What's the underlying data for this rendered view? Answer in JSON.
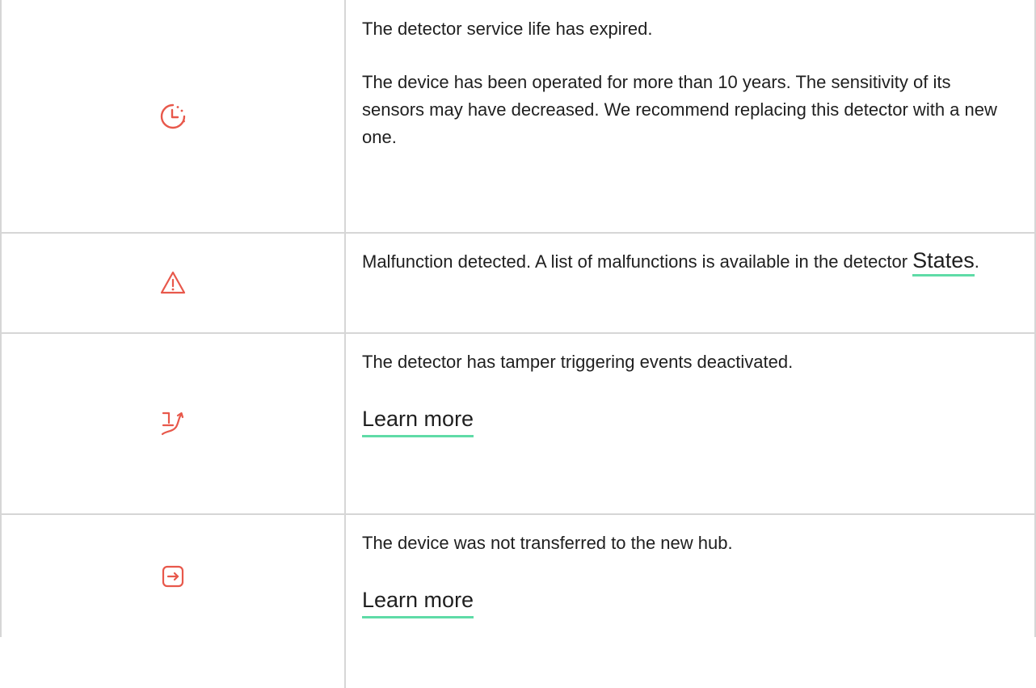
{
  "rows": [
    {
      "icon": "service-life-clock-icon",
      "lines": [
        "The detector service life has expired.",
        "The device has been operated for more than 10 years. The sensitivity of its sensors may have decreased. We recommend replacing this detector with a new one."
      ]
    },
    {
      "icon": "warning-triangle-icon",
      "text_before_link": "Malfunction detected. A list of malfunctions is available in the detector ",
      "link": "States",
      "text_after_link": "."
    },
    {
      "icon": "tamper-deactivated-icon",
      "text": "The detector has tamper triggering events deactivated.",
      "link": "Learn more"
    },
    {
      "icon": "transfer-arrow-icon",
      "text": "The device was not transferred to the new hub.",
      "link": "Learn more"
    }
  ],
  "colors": {
    "icon": "#e8584b",
    "link_underline": "#5fdba7",
    "grid": "#d6d6d6",
    "text": "#1f1f1f"
  }
}
